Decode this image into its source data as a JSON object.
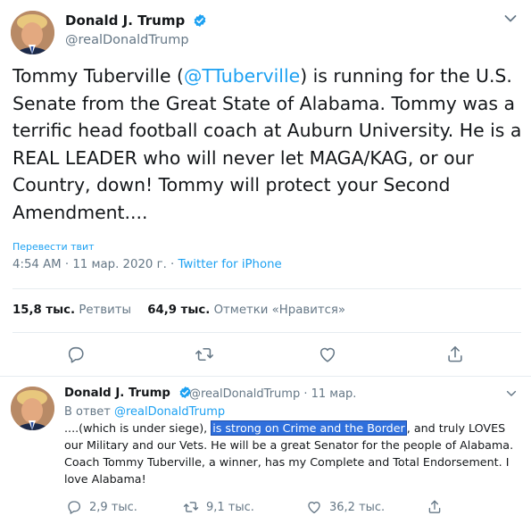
{
  "main_tweet": {
    "author_name": "Donald J. Trump",
    "author_handle": "@realDonaldTrump",
    "text_part1": "Tommy Tuberville (",
    "mention": "@TTuberville",
    "text_part2": ") is running for the U.S. Senate from the Great State of Alabama. Tommy was a terrific head football coach at Auburn University. He is a REAL LEADER who will never let MAGA/KAG, or our Country, down! Tommy will protect your Second Amendment....",
    "translate_label": "Перевести твит",
    "timestamp": "4:54 AM · 11 мар. 2020 г. · ",
    "source": "Twitter for iPhone",
    "retweets_count": "15,8 тыс.",
    "retweets_label": "Ретвиты",
    "likes_count": "64,9 тыс.",
    "likes_label": "Отметки «Нравится»"
  },
  "reply_tweet": {
    "author_name": "Donald J. Trump",
    "author_handle": "@realDonaldTrump · 11 мар.",
    "reply_to_prefix": "В ответ ",
    "reply_to_handle": "@realDonaldTrump",
    "text_before": "....(which is under siege), ",
    "text_highlighted": "is strong on Crime and the Border",
    "text_after": ", and truly LOVES our Military and our Vets. He will be a great Senator for the people of Alabama. Coach Tommy Tuberville, a winner, has my Complete and Total Endorsement. I love Alabama!",
    "replies_count": "2,9 тыс.",
    "retweets_count": "9,1 тыс.",
    "likes_count": "36,2 тыс."
  },
  "icons": {
    "verified": "verified-badge-icon",
    "caret": "chevron-down-icon",
    "reply": "reply-icon",
    "retweet": "retweet-icon",
    "like": "heart-icon",
    "share": "share-icon"
  },
  "colors": {
    "accent": "#1da1f2",
    "secondary_text": "#657786",
    "highlight": "#2f6fdc"
  }
}
